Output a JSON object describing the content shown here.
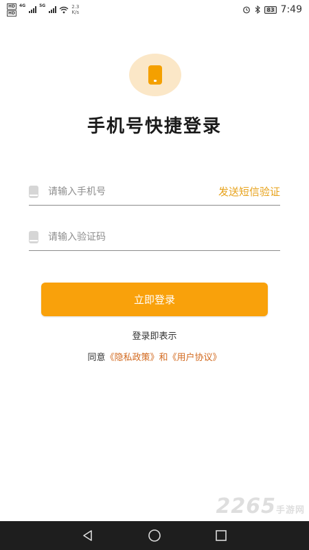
{
  "status_bar": {
    "hd1": "HD",
    "hd2": "HD",
    "net1": "4G",
    "net2": "5G",
    "speed_value": "2.3",
    "speed_unit": "K/s",
    "battery": "83",
    "time": "7:49",
    "icons": [
      "alarm-icon",
      "bluetooth-icon",
      "battery-icon"
    ]
  },
  "header": {
    "logo_icon": "phone-icon",
    "title": "手机号快捷登录"
  },
  "form": {
    "phone_placeholder": "请输入手机号",
    "phone_value": "",
    "send_code_label": "发送短信验证",
    "code_placeholder": "请输入验证码",
    "code_value": ""
  },
  "login_button_label": "立即登录",
  "agreement": {
    "line1": "登录即表示",
    "prefix": "同意",
    "privacy_link": "《隐私政策》",
    "conjunction": "和",
    "user_link": "《用户协议》"
  },
  "watermark": {
    "brand": "2265",
    "sub": "手游网"
  },
  "nav": {
    "icons": [
      "back-icon",
      "home-icon",
      "recents-icon"
    ]
  },
  "colors": {
    "accent": "#f9a10b",
    "link": "#d2691e",
    "send_code": "#e7a21a",
    "logo_bg": "#fbe7c7"
  }
}
